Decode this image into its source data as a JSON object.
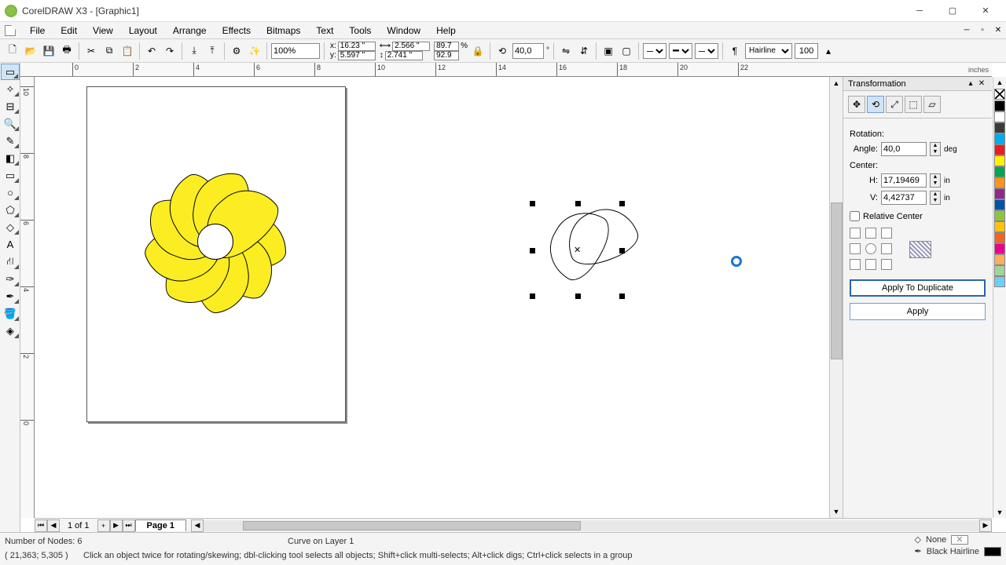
{
  "app": {
    "title": "CorelDRAW X3 - [Graphic1]"
  },
  "menu": {
    "items": [
      "File",
      "Edit",
      "View",
      "Layout",
      "Arrange",
      "Effects",
      "Bitmaps",
      "Text",
      "Tools",
      "Window",
      "Help"
    ]
  },
  "propbar": {
    "zoom": "100%",
    "x": "16.23 \"",
    "y": "5.597 \"",
    "w": "2.566 \"",
    "h": "2.741 \"",
    "sx": "89.7",
    "sy": "92.9",
    "angle": "40,0",
    "outline_width": "Hairline",
    "tint": "100"
  },
  "ruler": {
    "unit": "inches",
    "h_ticks": [
      0,
      2,
      4,
      6,
      8,
      10,
      12,
      14,
      16,
      18,
      20,
      22
    ],
    "v_ticks": [
      10,
      8,
      6,
      4,
      2,
      0
    ]
  },
  "page_nav": {
    "count": "1 of 1",
    "tab": "Page 1"
  },
  "status": {
    "nodes": "Number of Nodes: 6",
    "coords": "( 21,363; 5,305 )",
    "layer": "Curve on Layer 1",
    "hint": "Click an object twice for rotating/skewing; dbl-clicking tool selects all objects; Shift+click multi-selects; Alt+click digs; Ctrl+click selects in a group",
    "fill": "None",
    "outline": "Black  Hairline"
  },
  "docker": {
    "title": "Transformation",
    "rotation_label": "Rotation:",
    "angle_label": "Angle:",
    "angle_value": "40,0",
    "angle_unit": "deg",
    "center_label": "Center:",
    "h_label": "H:",
    "h_value": "17,19469",
    "h_unit": "in",
    "v_label": "V:",
    "v_value": "4,42737",
    "v_unit": "in",
    "relative_label": "Relative Center",
    "apply_dup": "Apply To Duplicate",
    "apply": "Apply"
  },
  "palette": [
    "#000000",
    "#ffffff",
    "#3b3b3b",
    "#00aeef",
    "#ed1c24",
    "#fff200",
    "#00a651",
    "#f7941d",
    "#92278f",
    "#0054a6",
    "#8dc63e",
    "#ffc20e",
    "#f26522",
    "#ec008c",
    "#fbaf5d",
    "#a3d39c",
    "#6dcff6"
  ]
}
